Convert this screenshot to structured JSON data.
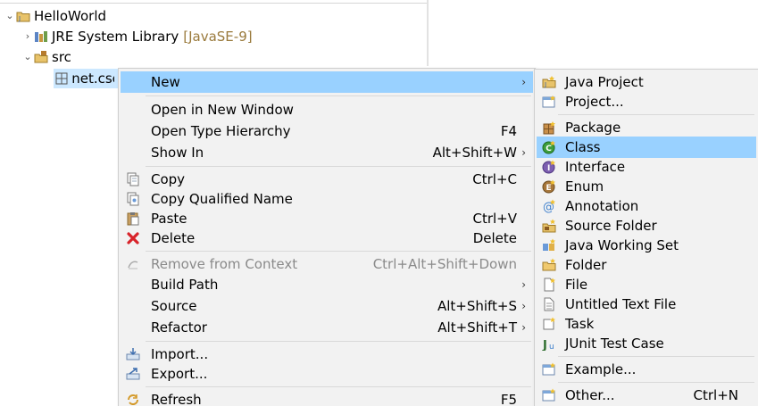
{
  "tree": {
    "project": {
      "label": "HelloWorld"
    },
    "jre": {
      "label": "JRE System Library",
      "decoration": "[JavaSE-9]"
    },
    "src": {
      "label": "src"
    },
    "package": {
      "label": "net.csc"
    }
  },
  "context_menu": {
    "new": {
      "label": "New"
    },
    "open_new_window": {
      "label": "Open in New Window"
    },
    "open_type_hierarchy": {
      "label": "Open Type Hierarchy",
      "shortcut": "F4"
    },
    "show_in": {
      "label": "Show In",
      "shortcut": "Alt+Shift+W"
    },
    "copy": {
      "label": "Copy",
      "shortcut": "Ctrl+C"
    },
    "copy_qualified": {
      "label": "Copy Qualified Name"
    },
    "paste": {
      "label": "Paste",
      "shortcut": "Ctrl+V"
    },
    "delete": {
      "label": "Delete",
      "shortcut": "Delete"
    },
    "remove_context": {
      "label": "Remove from Context",
      "shortcut": "Ctrl+Alt+Shift+Down"
    },
    "build_path": {
      "label": "Build Path"
    },
    "source": {
      "label": "Source",
      "shortcut": "Alt+Shift+S"
    },
    "refactor": {
      "label": "Refactor",
      "shortcut": "Alt+Shift+T"
    },
    "import": {
      "label": "Import..."
    },
    "export": {
      "label": "Export..."
    },
    "refresh": {
      "label": "Refresh",
      "shortcut": "F5"
    }
  },
  "new_submenu": {
    "java_project": {
      "label": "Java Project"
    },
    "project": {
      "label": "Project..."
    },
    "package": {
      "label": "Package"
    },
    "class": {
      "label": "Class"
    },
    "interface": {
      "label": "Interface"
    },
    "enum": {
      "label": "Enum"
    },
    "annotation": {
      "label": "Annotation"
    },
    "source_folder": {
      "label": "Source Folder"
    },
    "java_working_set": {
      "label": "Java Working Set"
    },
    "folder": {
      "label": "Folder"
    },
    "file": {
      "label": "File"
    },
    "untitled_text_file": {
      "label": "Untitled Text File"
    },
    "task": {
      "label": "Task"
    },
    "junit_test_case": {
      "label": "JUnit Test Case"
    },
    "example": {
      "label": "Example..."
    },
    "other": {
      "label": "Other...",
      "shortcut": "Ctrl+N"
    }
  },
  "colors": {
    "menu_highlight": "#99d1ff",
    "tree_selection": "#cce8ff",
    "menu_background": "#f2f2f2"
  }
}
